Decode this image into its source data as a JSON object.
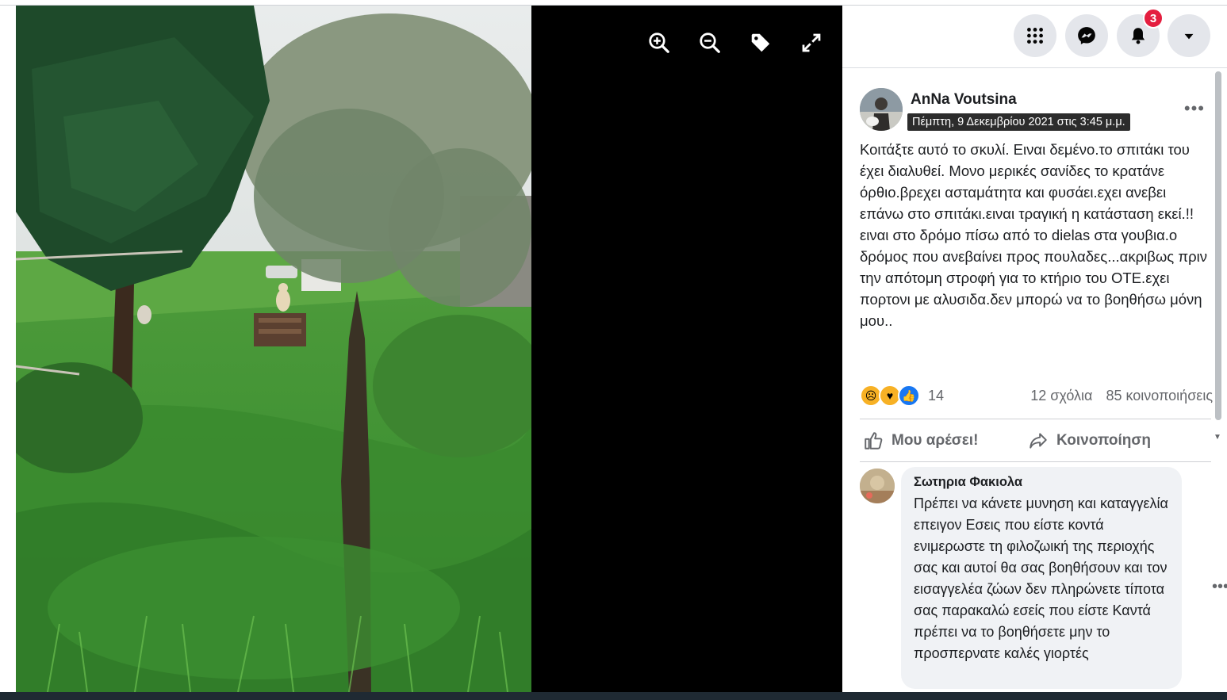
{
  "viewer": {
    "tools": [
      {
        "name": "zoom-in-icon"
      },
      {
        "name": "zoom-out-icon"
      },
      {
        "name": "tag-icon"
      },
      {
        "name": "fullscreen-icon"
      }
    ]
  },
  "header": {
    "notification_count": "3"
  },
  "post": {
    "author": "AnNa Voutsina",
    "timestamp": "Πέμπτη, 9 Δεκεμβρίου 2021 στις 3:45 μ.μ.",
    "text": "Κοιτάξτε αυτό το σκυλί. Ειναι δεμένο.το σπιτάκι του έχει διαλυθεί. Μονο μερικές σανίδες το κρατάνε όρθιο.βρεχει ασταμάτητα και φυσάει.εχει ανεβει επάνω στο σπιτάκι.ειναι τραγική η κατάσταση εκεί.!!ειναι στο δρόμο πίσω από το dielas στα γουβια.ο δρόμος που ανεβαίνει προς πουλαδες...ακριβως πριν την απότομη στροφή για το κτήριο του ΟΤΕ.εχει πορτονι με αλυσιδα.δεν μπορώ να το βοηθήσω μόνη μου..",
    "reaction_count": "14",
    "comments_label": "12 σχόλια",
    "shares_label": "85 κοινοποιήσεις",
    "like_label": "Μου αρέσει!",
    "share_label": "Κοινοποίηση"
  },
  "comment": {
    "name": "Σωτηρια Φακιολα",
    "text": "Πρέπει να κάνετε μυνηση και καταγγελία επειγον Εσεις που είστε κοντά ενιμερωστε τη φιλοζωική της περιοχής σας και αυτοί θα σας βοηθήσουν και τον εισαγγελέα ζώων δεν πληρώνετε τίποτα σας παρακαλώ εσείς που είστε Καντά πρέπει να το βοηθήσετε μην το προσπερνατε καλές γιορτές"
  },
  "colors": {
    "badge": "#e41e3f",
    "like_blue": "#1877f2",
    "muted_text": "#65676b"
  }
}
